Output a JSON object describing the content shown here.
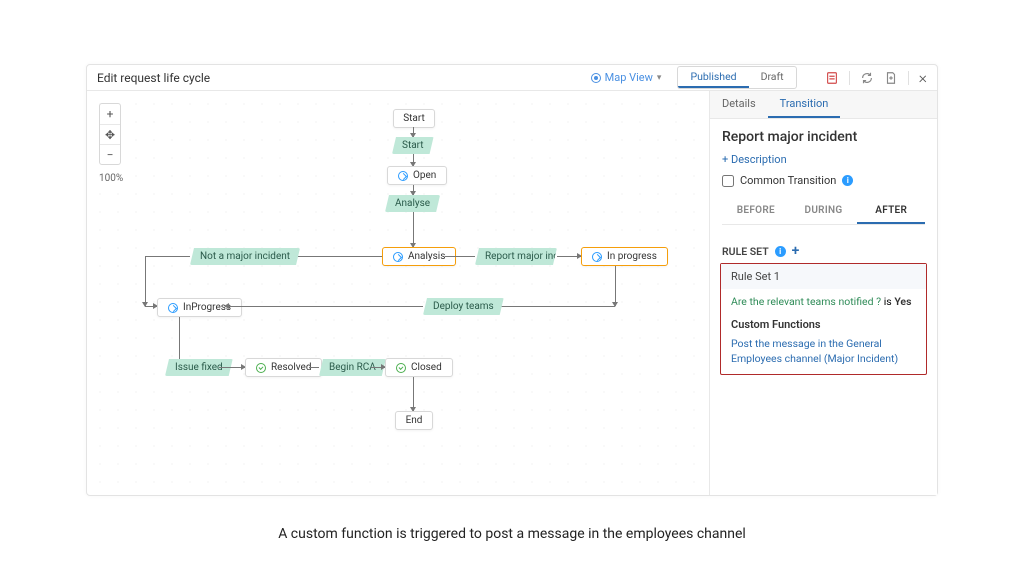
{
  "header": {
    "title": "Edit request life cycle",
    "view_label": "Map View",
    "toggle": {
      "published": "Published",
      "draft": "Draft",
      "active": "published"
    }
  },
  "zoom": {
    "level": "100%"
  },
  "nodes": {
    "start": "Start",
    "open": "Open",
    "analysis": "Analysis",
    "in_progress_right": "In progress",
    "in_progress_left": "InProgress",
    "resolved": "Resolved",
    "closed": "Closed",
    "end": "End"
  },
  "transitions": {
    "start": "Start",
    "analyse": "Analyse",
    "not_major": "Not a major incident",
    "report_major": "Report major inci...",
    "deploy_teams": "Deploy teams",
    "issue_fixed": "Issue fixed",
    "begin_rca": "Begin RCA"
  },
  "panel": {
    "tabs": {
      "details": "Details",
      "transition": "Transition",
      "active": "transition"
    },
    "title": "Report major incident",
    "add_description": "+ Description",
    "common_transition": "Common Transition",
    "subtabs": {
      "before": "BEFORE",
      "during": "DURING",
      "after": "AFTER",
      "active": "after"
    },
    "ruleset_label": "RULE SET",
    "rule": {
      "title": "Rule Set 1",
      "condition_q": "Are the relevant teams notified ?",
      "condition_join": " is ",
      "condition_a": "Yes",
      "section": "Custom Functions",
      "fn": "Post the message in the General Employees channel (Major Incident)"
    }
  },
  "caption": "A custom function is triggered to post a message in the employees channel"
}
